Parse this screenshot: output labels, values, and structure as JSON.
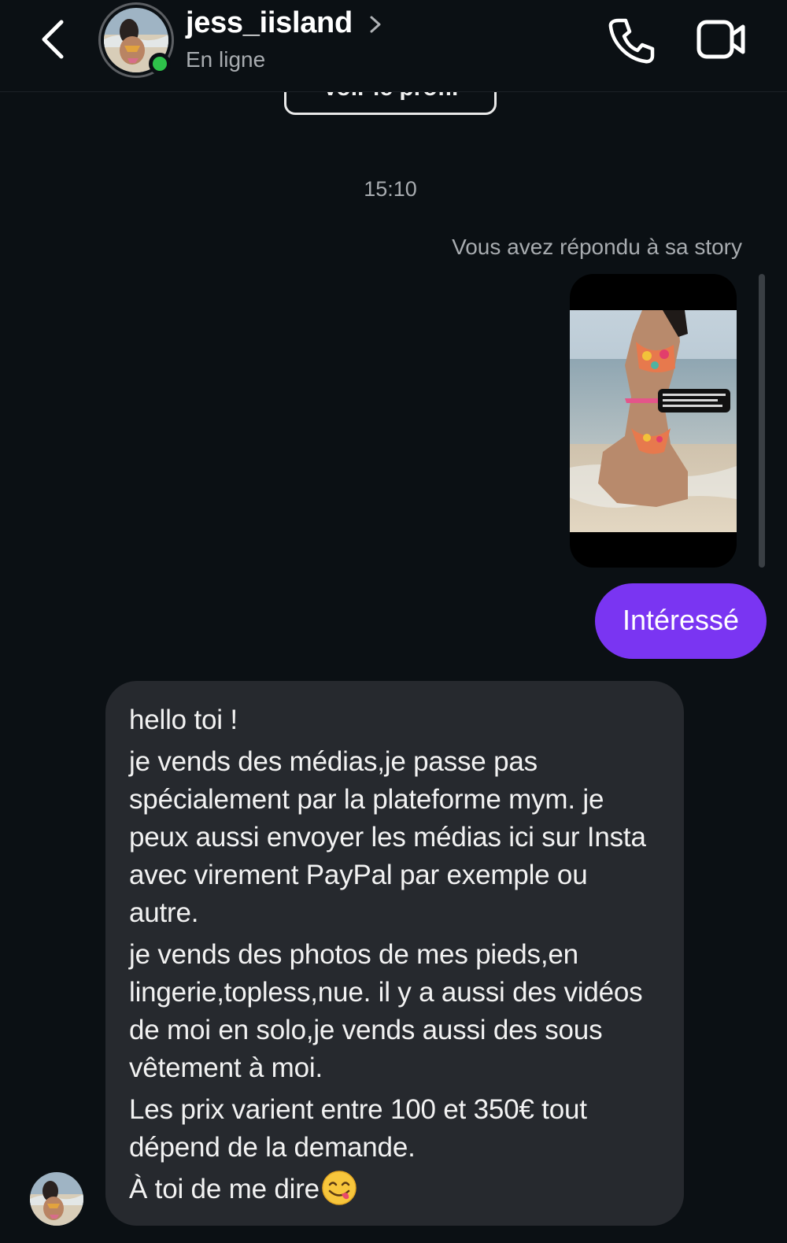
{
  "header": {
    "username": "jess_iisland",
    "status": "En ligne",
    "back_icon": "chevron-left-icon",
    "call_icon": "phone-icon",
    "video_icon": "video-camera-icon",
    "online_color": "#2ec24a"
  },
  "thread": {
    "profile_button_label": "Voir le profil",
    "timestamp": "15:10",
    "story_reply_note": "Vous avez répondu à sa story",
    "story_caption": "hello! je vends des médias privés si ça t'intéresse envoie moi « intéressé »",
    "outgoing_message": "Intéressé",
    "outgoing_color": "#7a35f2",
    "incoming_lines": [
      "hello toi !",
      "je vends des médias,je passe pas spécialement par la plateforme mym. je peux aussi envoyer les médias ici sur Insta avec virement PayPal par exemple ou autre.",
      "je vends des photos de mes pieds,en lingerie,topless,nue. il y a aussi des vidéos de moi en solo,je vends aussi des sous vêtement à moi.",
      "Les prix varient entre 100 et 350€ tout dépend de la demande.",
      "À toi de me dire"
    ],
    "incoming_emoji": "face-savoring-food-emoji"
  }
}
